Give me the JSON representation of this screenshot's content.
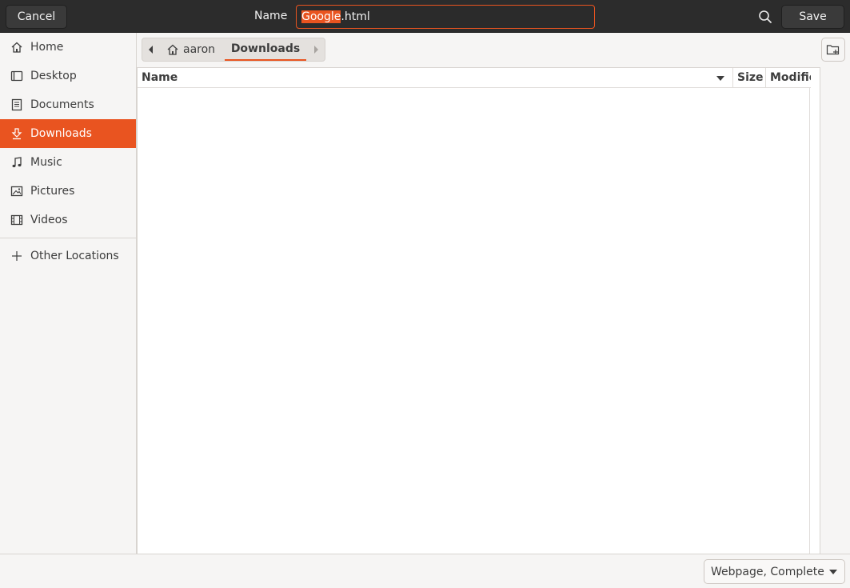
{
  "header": {
    "cancel_label": "Cancel",
    "name_label": "Name",
    "filename_selected": "Google",
    "filename_rest": ".html",
    "save_label": "Save",
    "search_icon": "search-icon"
  },
  "sidebar": {
    "items": [
      {
        "label": "Home",
        "icon": "home-icon"
      },
      {
        "label": "Desktop",
        "icon": "desktop-icon"
      },
      {
        "label": "Documents",
        "icon": "document-icon"
      },
      {
        "label": "Downloads",
        "icon": "download-icon",
        "active": true
      },
      {
        "label": "Music",
        "icon": "music-icon"
      },
      {
        "label": "Pictures",
        "icon": "picture-icon"
      },
      {
        "label": "Videos",
        "icon": "video-icon"
      },
      {
        "label": "Other Locations",
        "icon": "plus-icon"
      }
    ]
  },
  "pathbar": {
    "home_label": "aaron",
    "current_label": "Downloads"
  },
  "filelist": {
    "columns": [
      "Name",
      "Size",
      "Modified"
    ],
    "rows": []
  },
  "footer": {
    "filetype_value": "Webpage, Complete"
  },
  "colors": {
    "accent": "#e95420",
    "header_bg": "#2c2c2c",
    "sidebar_bg": "#f6f5f4"
  }
}
